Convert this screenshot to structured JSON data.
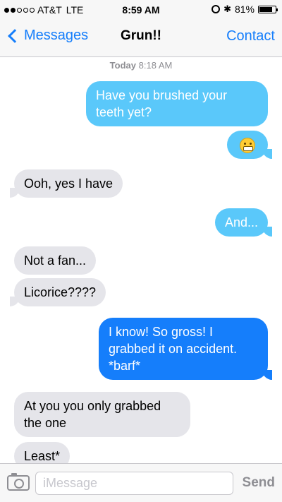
{
  "status_bar": {
    "carrier": "AT&T",
    "network": "LTE",
    "time": "8:59 AM",
    "battery": "81%",
    "battery_level": 0.81,
    "signal_bars": 2
  },
  "nav": {
    "back_label": "Messages",
    "title": "Grun!!",
    "contact_label": "Contact"
  },
  "conversation": {
    "timestamp_day": "Today",
    "timestamp_time": "8:18 AM",
    "messages": [
      {
        "direction": "outgoing",
        "text": "Have you brushed your teeth yet?"
      },
      {
        "direction": "outgoing",
        "emoji": "grimacing-face"
      },
      {
        "direction": "incoming",
        "text": "Ooh, yes I have"
      },
      {
        "direction": "outgoing",
        "text": "And..."
      },
      {
        "direction": "incoming",
        "text": "Not a fan..."
      },
      {
        "direction": "incoming",
        "text": "Licorice????"
      },
      {
        "direction": "outgoing",
        "text": "I know! So gross! I grabbed it on accident. *barf*"
      },
      {
        "direction": "incoming",
        "text": "At you you only grabbed the one"
      },
      {
        "direction": "incoming",
        "text": "Least*"
      }
    ]
  },
  "input_bar": {
    "placeholder": "iMessage",
    "send_label": "Send"
  },
  "colors": {
    "imessage_blue": "#5ac8fa",
    "sms_blue": "#157efb",
    "incoming_gray": "#e5e5ea",
    "accent": "#157efb"
  }
}
